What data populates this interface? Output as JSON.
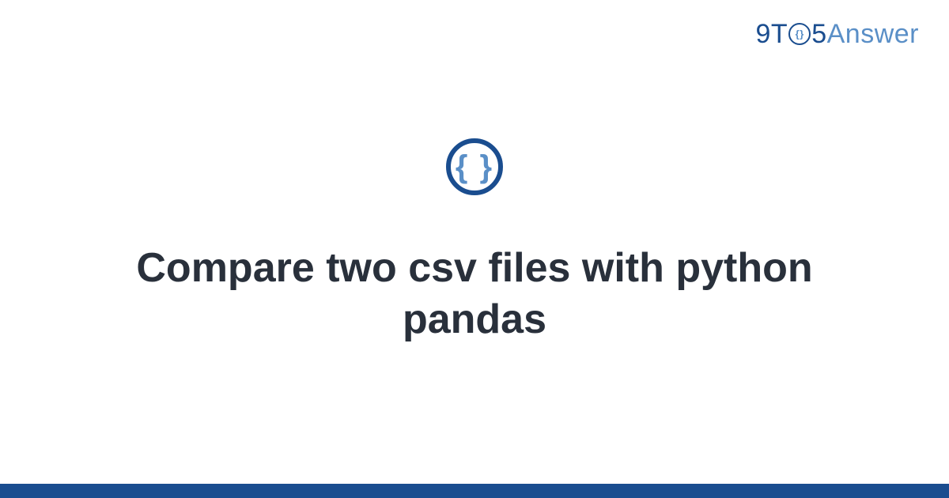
{
  "brand": {
    "part_9": "9",
    "part_T": "T",
    "part_O_inner": "{}",
    "part_5": "5",
    "part_answer": "Answer"
  },
  "icon": {
    "braces": "{ }"
  },
  "title": "Compare two csv files with python pandas",
  "colors": {
    "primary": "#1a4d8f",
    "secondary": "#5a8fc7",
    "text": "#29303b"
  }
}
